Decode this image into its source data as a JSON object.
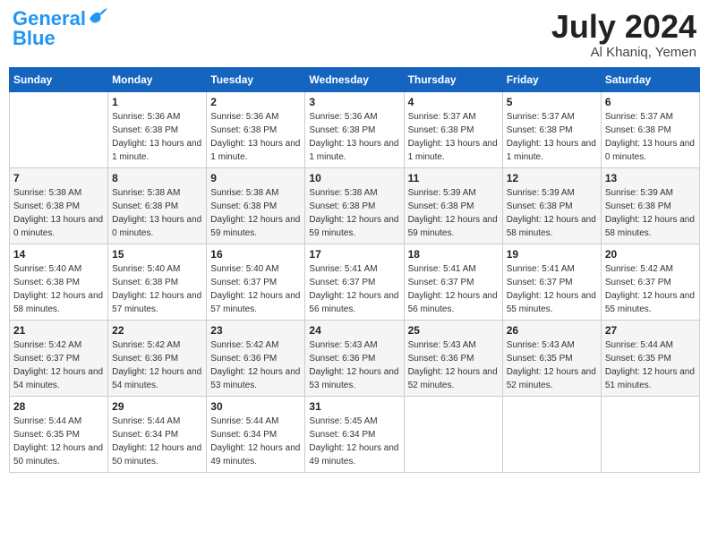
{
  "header": {
    "logo_general": "General",
    "logo_blue": "Blue",
    "month_year": "July 2024",
    "location": "Al Khaniq, Yemen"
  },
  "days_of_week": [
    "Sunday",
    "Monday",
    "Tuesday",
    "Wednesday",
    "Thursday",
    "Friday",
    "Saturday"
  ],
  "weeks": [
    [
      {
        "date": "",
        "info": ""
      },
      {
        "date": "1",
        "sunrise": "5:36 AM",
        "sunset": "6:38 PM",
        "daylight": "13 hours and 1 minute."
      },
      {
        "date": "2",
        "sunrise": "5:36 AM",
        "sunset": "6:38 PM",
        "daylight": "13 hours and 1 minute."
      },
      {
        "date": "3",
        "sunrise": "5:36 AM",
        "sunset": "6:38 PM",
        "daylight": "13 hours and 1 minute."
      },
      {
        "date": "4",
        "sunrise": "5:37 AM",
        "sunset": "6:38 PM",
        "daylight": "13 hours and 1 minute."
      },
      {
        "date": "5",
        "sunrise": "5:37 AM",
        "sunset": "6:38 PM",
        "daylight": "13 hours and 1 minute."
      },
      {
        "date": "6",
        "sunrise": "5:37 AM",
        "sunset": "6:38 PM",
        "daylight": "13 hours and 0 minutes."
      }
    ],
    [
      {
        "date": "7",
        "sunrise": "5:38 AM",
        "sunset": "6:38 PM",
        "daylight": "13 hours and 0 minutes."
      },
      {
        "date": "8",
        "sunrise": "5:38 AM",
        "sunset": "6:38 PM",
        "daylight": "13 hours and 0 minutes."
      },
      {
        "date": "9",
        "sunrise": "5:38 AM",
        "sunset": "6:38 PM",
        "daylight": "12 hours and 59 minutes."
      },
      {
        "date": "10",
        "sunrise": "5:38 AM",
        "sunset": "6:38 PM",
        "daylight": "12 hours and 59 minutes."
      },
      {
        "date": "11",
        "sunrise": "5:39 AM",
        "sunset": "6:38 PM",
        "daylight": "12 hours and 59 minutes."
      },
      {
        "date": "12",
        "sunrise": "5:39 AM",
        "sunset": "6:38 PM",
        "daylight": "12 hours and 58 minutes."
      },
      {
        "date": "13",
        "sunrise": "5:39 AM",
        "sunset": "6:38 PM",
        "daylight": "12 hours and 58 minutes."
      }
    ],
    [
      {
        "date": "14",
        "sunrise": "5:40 AM",
        "sunset": "6:38 PM",
        "daylight": "12 hours and 58 minutes."
      },
      {
        "date": "15",
        "sunrise": "5:40 AM",
        "sunset": "6:38 PM",
        "daylight": "12 hours and 57 minutes."
      },
      {
        "date": "16",
        "sunrise": "5:40 AM",
        "sunset": "6:37 PM",
        "daylight": "12 hours and 57 minutes."
      },
      {
        "date": "17",
        "sunrise": "5:41 AM",
        "sunset": "6:37 PM",
        "daylight": "12 hours and 56 minutes."
      },
      {
        "date": "18",
        "sunrise": "5:41 AM",
        "sunset": "6:37 PM",
        "daylight": "12 hours and 56 minutes."
      },
      {
        "date": "19",
        "sunrise": "5:41 AM",
        "sunset": "6:37 PM",
        "daylight": "12 hours and 55 minutes."
      },
      {
        "date": "20",
        "sunrise": "5:42 AM",
        "sunset": "6:37 PM",
        "daylight": "12 hours and 55 minutes."
      }
    ],
    [
      {
        "date": "21",
        "sunrise": "5:42 AM",
        "sunset": "6:37 PM",
        "daylight": "12 hours and 54 minutes."
      },
      {
        "date": "22",
        "sunrise": "5:42 AM",
        "sunset": "6:36 PM",
        "daylight": "12 hours and 54 minutes."
      },
      {
        "date": "23",
        "sunrise": "5:42 AM",
        "sunset": "6:36 PM",
        "daylight": "12 hours and 53 minutes."
      },
      {
        "date": "24",
        "sunrise": "5:43 AM",
        "sunset": "6:36 PM",
        "daylight": "12 hours and 53 minutes."
      },
      {
        "date": "25",
        "sunrise": "5:43 AM",
        "sunset": "6:36 PM",
        "daylight": "12 hours and 52 minutes."
      },
      {
        "date": "26",
        "sunrise": "5:43 AM",
        "sunset": "6:35 PM",
        "daylight": "12 hours and 52 minutes."
      },
      {
        "date": "27",
        "sunrise": "5:44 AM",
        "sunset": "6:35 PM",
        "daylight": "12 hours and 51 minutes."
      }
    ],
    [
      {
        "date": "28",
        "sunrise": "5:44 AM",
        "sunset": "6:35 PM",
        "daylight": "12 hours and 50 minutes."
      },
      {
        "date": "29",
        "sunrise": "5:44 AM",
        "sunset": "6:34 PM",
        "daylight": "12 hours and 50 minutes."
      },
      {
        "date": "30",
        "sunrise": "5:44 AM",
        "sunset": "6:34 PM",
        "daylight": "12 hours and 49 minutes."
      },
      {
        "date": "31",
        "sunrise": "5:45 AM",
        "sunset": "6:34 PM",
        "daylight": "12 hours and 49 minutes."
      },
      {
        "date": "",
        "info": ""
      },
      {
        "date": "",
        "info": ""
      },
      {
        "date": "",
        "info": ""
      }
    ]
  ]
}
